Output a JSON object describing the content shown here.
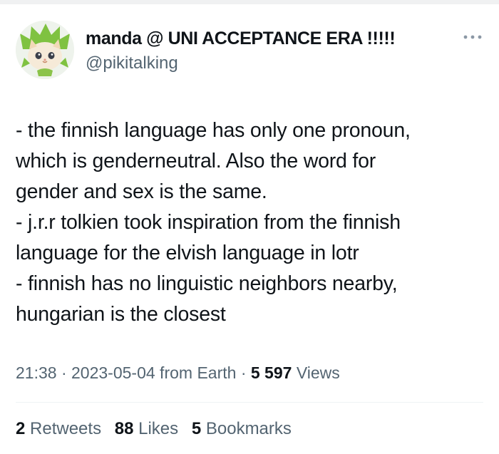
{
  "author": {
    "display_name": "manda @ UNI ACCEPTANCE ERA !!!!!",
    "handle": "@pikitalking",
    "avatar_icon": "green-haired-cat-girl-avatar"
  },
  "more_icon": "more-horizontal-icon",
  "tweet": {
    "lines": [
      "- the finnish language has only one pronoun,",
      "which is genderneutral. Also the word for",
      "gender and sex is the same.",
      "- j.r.r tolkien took inspiration from the finnish",
      "language for the elvish language in lotr",
      "- finnish has no linguistic neighbors nearby,",
      "hungarian is the closest"
    ]
  },
  "meta": {
    "time": "21:38",
    "separator": "·",
    "date_source": "2023-05-04 from Earth",
    "views_count": "5 597",
    "views_label": "Views"
  },
  "stats": {
    "retweets_count": "2",
    "retweets_label": "Retweets",
    "likes_count": "88",
    "likes_label": "Likes",
    "bookmarks_count": "5",
    "bookmarks_label": "Bookmarks"
  },
  "colors": {
    "text_primary": "#0f1419",
    "text_secondary": "#536471",
    "divider": "#eff3f4"
  }
}
